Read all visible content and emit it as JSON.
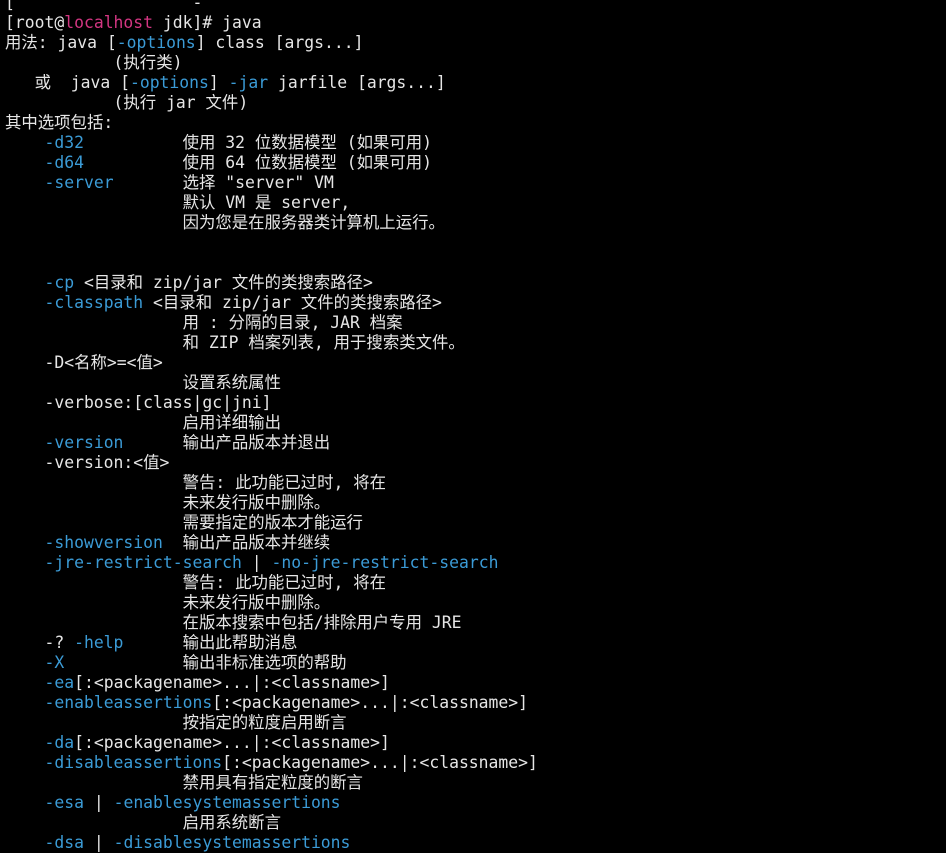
{
  "colors": {
    "background": "#000000",
    "text": "#e6e6e6",
    "option": "#3b9bd6",
    "host": "#d33682"
  },
  "terminal": {
    "lines": [
      [
        {
          "t": "[    ",
          "c": "n"
        },
        {
          "t": "",
          "c": "n"
        },
        {
          "t": "              ",
          "c": "n"
        },
        {
          "t": "-  ",
          "c": "n"
        }
      ],
      [
        {
          "t": "[root@",
          "c": "n"
        },
        {
          "t": "localhost",
          "c": "h"
        },
        {
          "t": " jdk]# java",
          "c": "n"
        }
      ],
      [
        {
          "t": "用法: java [",
          "c": "n"
        },
        {
          "t": "-options",
          "c": "o"
        },
        {
          "t": "] class [args...]",
          "c": "n"
        }
      ],
      [
        {
          "t": "           (执行类)",
          "c": "n"
        }
      ],
      [
        {
          "t": "   或  java [",
          "c": "n"
        },
        {
          "t": "-options",
          "c": "o"
        },
        {
          "t": "] ",
          "c": "n"
        },
        {
          "t": "-jar",
          "c": "o"
        },
        {
          "t": " jarfile [args...]",
          "c": "n"
        }
      ],
      [
        {
          "t": "           (执行 jar 文件)",
          "c": "n"
        }
      ],
      [
        {
          "t": "其中选项包括:",
          "c": "n"
        }
      ],
      [
        {
          "t": "    ",
          "c": "n"
        },
        {
          "t": "-d32",
          "c": "o"
        },
        {
          "t": "          使用 32 位数据模型 (如果可用)",
          "c": "n"
        }
      ],
      [
        {
          "t": "    ",
          "c": "n"
        },
        {
          "t": "-d64",
          "c": "o"
        },
        {
          "t": "          使用 64 位数据模型 (如果可用)",
          "c": "n"
        }
      ],
      [
        {
          "t": "    ",
          "c": "n"
        },
        {
          "t": "-server",
          "c": "o"
        },
        {
          "t": "       选择 \"server\" VM",
          "c": "n"
        }
      ],
      [
        {
          "t": "                  默认 VM 是 server,",
          "c": "n"
        }
      ],
      [
        {
          "t": "                  因为您是在服务器类计算机上运行。",
          "c": "n"
        }
      ],
      [
        {
          "t": "",
          "c": "n"
        }
      ],
      [
        {
          "t": "",
          "c": "n"
        }
      ],
      [
        {
          "t": "    ",
          "c": "n"
        },
        {
          "t": "-cp",
          "c": "o"
        },
        {
          "t": " <目录和 zip/jar 文件的类搜索路径>",
          "c": "n"
        }
      ],
      [
        {
          "t": "    ",
          "c": "n"
        },
        {
          "t": "-classpath",
          "c": "o"
        },
        {
          "t": " <目录和 zip/jar 文件的类搜索路径>",
          "c": "n"
        }
      ],
      [
        {
          "t": "                  用 : 分隔的目录, JAR 档案",
          "c": "n"
        }
      ],
      [
        {
          "t": "                  和 ZIP 档案列表, 用于搜索类文件。",
          "c": "n"
        }
      ],
      [
        {
          "t": "    -D<名称>=<值>",
          "c": "n"
        }
      ],
      [
        {
          "t": "                  设置系统属性",
          "c": "n"
        }
      ],
      [
        {
          "t": "    -verbose:[class|gc|jni]",
          "c": "n"
        }
      ],
      [
        {
          "t": "                  启用详细输出",
          "c": "n"
        }
      ],
      [
        {
          "t": "    ",
          "c": "n"
        },
        {
          "t": "-version",
          "c": "o"
        },
        {
          "t": "      输出产品版本并退出",
          "c": "n"
        }
      ],
      [
        {
          "t": "    -version:<值>",
          "c": "n"
        }
      ],
      [
        {
          "t": "                  警告: 此功能已过时, 将在",
          "c": "n"
        }
      ],
      [
        {
          "t": "                  未来发行版中删除。",
          "c": "n"
        }
      ],
      [
        {
          "t": "                  需要指定的版本才能运行",
          "c": "n"
        }
      ],
      [
        {
          "t": "    ",
          "c": "n"
        },
        {
          "t": "-showversion",
          "c": "o"
        },
        {
          "t": "  输出产品版本并继续",
          "c": "n"
        }
      ],
      [
        {
          "t": "    ",
          "c": "n"
        },
        {
          "t": "-jre-restrict-search",
          "c": "o"
        },
        {
          "t": " | ",
          "c": "n"
        },
        {
          "t": "-no-jre-restrict-search",
          "c": "o"
        }
      ],
      [
        {
          "t": "                  警告: 此功能已过时, 将在",
          "c": "n"
        }
      ],
      [
        {
          "t": "                  未来发行版中删除。",
          "c": "n"
        }
      ],
      [
        {
          "t": "                  在版本搜索中包括/排除用户专用 JRE",
          "c": "n"
        }
      ],
      [
        {
          "t": "    -? ",
          "c": "n"
        },
        {
          "t": "-help",
          "c": "o"
        },
        {
          "t": "      输出此帮助消息",
          "c": "n"
        }
      ],
      [
        {
          "t": "    ",
          "c": "n"
        },
        {
          "t": "-X",
          "c": "o"
        },
        {
          "t": "            输出非标准选项的帮助",
          "c": "n"
        }
      ],
      [
        {
          "t": "    ",
          "c": "n"
        },
        {
          "t": "-ea",
          "c": "o"
        },
        {
          "t": "[:<packagename>...|:<classname>]",
          "c": "n"
        }
      ],
      [
        {
          "t": "    ",
          "c": "n"
        },
        {
          "t": "-enableassertions",
          "c": "o"
        },
        {
          "t": "[:<packagename>...|:<classname>]",
          "c": "n"
        }
      ],
      [
        {
          "t": "                  按指定的粒度启用断言",
          "c": "n"
        }
      ],
      [
        {
          "t": "    ",
          "c": "n"
        },
        {
          "t": "-da",
          "c": "o"
        },
        {
          "t": "[:<packagename>...|:<classname>]",
          "c": "n"
        }
      ],
      [
        {
          "t": "    ",
          "c": "n"
        },
        {
          "t": "-disableassertions",
          "c": "o"
        },
        {
          "t": "[:<packagename>...|:<classname>]",
          "c": "n"
        }
      ],
      [
        {
          "t": "                  禁用具有指定粒度的断言",
          "c": "n"
        }
      ],
      [
        {
          "t": "    ",
          "c": "n"
        },
        {
          "t": "-esa",
          "c": "o"
        },
        {
          "t": " | ",
          "c": "n"
        },
        {
          "t": "-enablesystemassertions",
          "c": "o"
        }
      ],
      [
        {
          "t": "                  启用系统断言",
          "c": "n"
        }
      ],
      [
        {
          "t": "    ",
          "c": "n"
        },
        {
          "t": "-dsa",
          "c": "o"
        },
        {
          "t": " | ",
          "c": "n"
        },
        {
          "t": "-disablesystemassertions",
          "c": "o"
        }
      ]
    ]
  }
}
